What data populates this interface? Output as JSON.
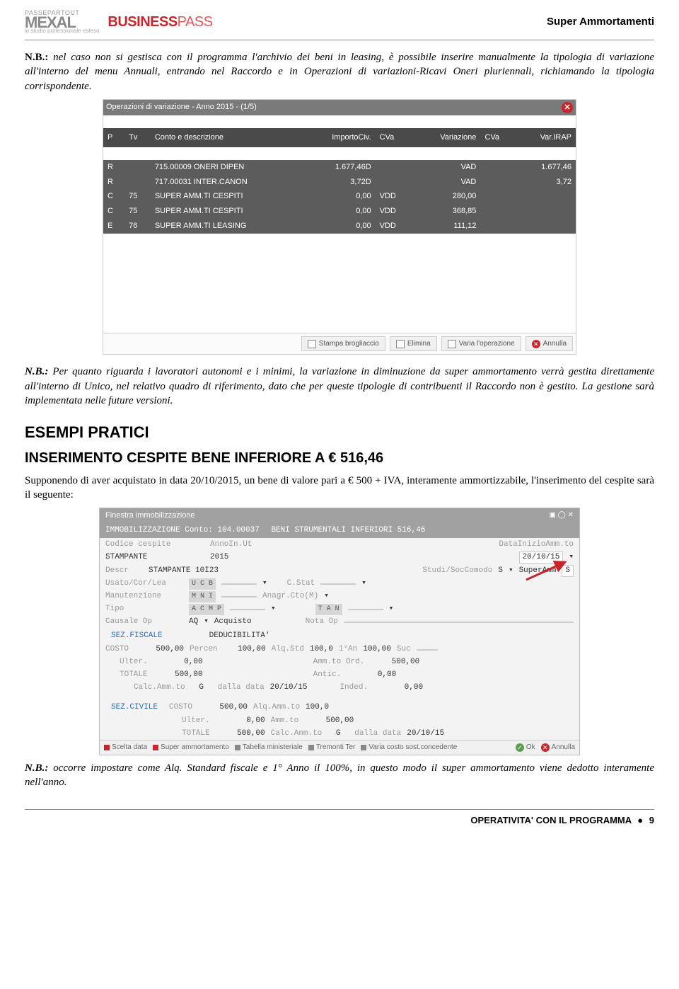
{
  "header": {
    "logo1_top": "PASSEPARTOUT",
    "logo1_brand": "MEXAL",
    "logo1_sub": "lo studio professionale esteso",
    "logo2_a": "BUSINESS",
    "logo2_b": "PASS",
    "doc_title": "Super Ammortamenti"
  },
  "p1": {
    "nb": "N.B.:",
    "text": " nel caso non si gestisca con il programma l'archivio dei beni in leasing, è possibile inserire manualmente la tipologia di variazione all'interno del menu Annuali, entrando nel Raccordo e in Operazioni di variazioni-Ricavi Oneri pluriennali, richiamando la tipologia corrispondente."
  },
  "ss1": {
    "title": "Operazioni di variazione - Anno 2015 - (1/5)",
    "cols": {
      "p": "P",
      "tv": "Tv",
      "desc": "Conto e descrizione",
      "imp": "ImportoCiv.",
      "cva": "CVa",
      "var": "Variazione",
      "cva2": "CVa",
      "irap": "Var.IRAP"
    },
    "rows": [
      {
        "p": "R",
        "tv": "",
        "desc": "715.00009 ONERI DIPEN",
        "imp": "1.677,46D",
        "cva": "",
        "var": "VAD",
        "cva2": "",
        "irap": "1.677,46"
      },
      {
        "p": "R",
        "tv": "",
        "desc": "717.00031 INTER.CANON",
        "imp": "3,72D",
        "cva": "",
        "var": "VAD",
        "cva2": "",
        "irap": "3,72"
      },
      {
        "p": "C",
        "tv": "75",
        "desc": "SUPER AMM.TI CESPITI",
        "imp": "0,00",
        "cva": "VDD",
        "var": "280,00",
        "cva2": "",
        "irap": ""
      },
      {
        "p": "C",
        "tv": "75",
        "desc": "SUPER AMM.TI CESPITI",
        "imp": "0,00",
        "cva": "VDD",
        "var": "368,85",
        "cva2": "",
        "irap": ""
      },
      {
        "p": "E",
        "tv": "76",
        "desc": "SUPER AMM.TI LEASING",
        "imp": "0,00",
        "cva": "VDD",
        "var": "111,12",
        "cva2": "",
        "irap": ""
      }
    ],
    "buttons": {
      "b1": "Stampa brogliaccio",
      "b2": "Elimina",
      "b3": "Varia l'operazione",
      "b4": "Annulla"
    }
  },
  "p2": {
    "nb": "N.B.:",
    "text": " Per quanto riguarda i lavoratori autonomi e i minimi, la variazione in diminuzione da super ammortamento verrà gestita direttamente all'interno di Unico, nel relativo quadro di riferimento, dato che per queste tipologie di contribuenti il Raccordo non è gestito. La gestione sarà implementata nelle future versioni."
  },
  "h1": "ESEMPI PRATICI",
  "h2": "INSERIMENTO CESPITE BENE INFERIORE A € 516,46",
  "p3": "Supponendo di aver acquistato in data 20/10/2015, un bene di valore pari a € 500 + IVA, interamente ammortizzabile, l'inserimento del cespite sarà il seguente:",
  "ss2": {
    "wintitle": "Finestra immobilizzazione",
    "hdr_l": "IMMOBILIZZAZIONE    Conto: 104.00037",
    "hdr_r": "BENI STRUMENTALI INFERIORI 516,46",
    "codice_lbl": "Codice cespite",
    "anno_lbl": "AnnoIn.Ut",
    "datainizio_lbl": "DataInizioAmm.to",
    "codice": "STAMPANTE",
    "anno": "2015",
    "datainizio": "20/10/15",
    "descr_lbl": "Descr",
    "descr": "STAMPANTE 10I23",
    "studi_lbl": "Studi/SocComodo",
    "studi_v": "S",
    "studi_txt": "SuperAmm",
    "studi_s": "S",
    "usato_lbl": "Usato/Cor/Lea",
    "usato_caps": "U C B",
    "cstat": "C.Stat",
    "manu_lbl": "Manutenzione",
    "manu_caps": "M N I",
    "anagr": "Anagr.Cto(M)",
    "tipo_lbl": "Tipo",
    "tipo_caps": "A C M P",
    "tan": "T A N",
    "causale_lbl": "Causale Op",
    "causale": "AQ",
    "causale_txt": "Acquisto",
    "nota_lbl": "Nota Op",
    "sec_fisc": "SEZ.FISCALE",
    "deduc": "DEDUCIBILITA'",
    "costo_lbl": "COSTO",
    "costo": "500,00",
    "percen_lbl": "Percen",
    "percen": "100,00",
    "alqstd_lbl": "Alq.Std",
    "alqstd": "100,0",
    "primo_lbl": "1°An",
    "primo": "100,00",
    "suc_lbl": "Suc",
    "ulter_lbl": "Ulter.",
    "ulter": "0,00",
    "ammord_lbl": "Amm.to Ord.",
    "ammord": "500,00",
    "totale_lbl": "TOTALE",
    "totale": "500,00",
    "antic_lbl": "Antic.",
    "antic": "0,00",
    "calc_lbl": "Calc.Amm.to",
    "calc": "G",
    "dalla_lbl": "dalla data",
    "dalla": "20/10/15",
    "inded_lbl": "Inded.",
    "inded": "0,00",
    "sec_civ": "SEZ.CIVILE",
    "costo2": "500,00",
    "alqamm_lbl": "Alq.Amm.to",
    "alqamm": "100,0",
    "ulter2": "0,00",
    "ammto_lbl": "Amm.to",
    "ammto": "500,00",
    "totale2": "500,00",
    "calc2": "G",
    "dalla2": "20/10/15",
    "fbtn1": "Scelta data",
    "fbtn2": "Super ammortamento",
    "fbtn3": "Tabella ministeriale",
    "fbtn4": "Tremonti Ter",
    "fbtn5": "Varia costo sost.concedente",
    "fbtn_ok": "Ok",
    "fbtn_ann": "Annulla"
  },
  "p4": {
    "nb": "N.B.:",
    "text": " occorre impostare come Alq. Standard fiscale e 1° Anno  il 100%, in questo modo il super ammortamento viene dedotto interamente nell'anno."
  },
  "footer": {
    "text": "OPERATIVITA' CON IL PROGRAMMA",
    "bullet": "●",
    "page": "9"
  }
}
